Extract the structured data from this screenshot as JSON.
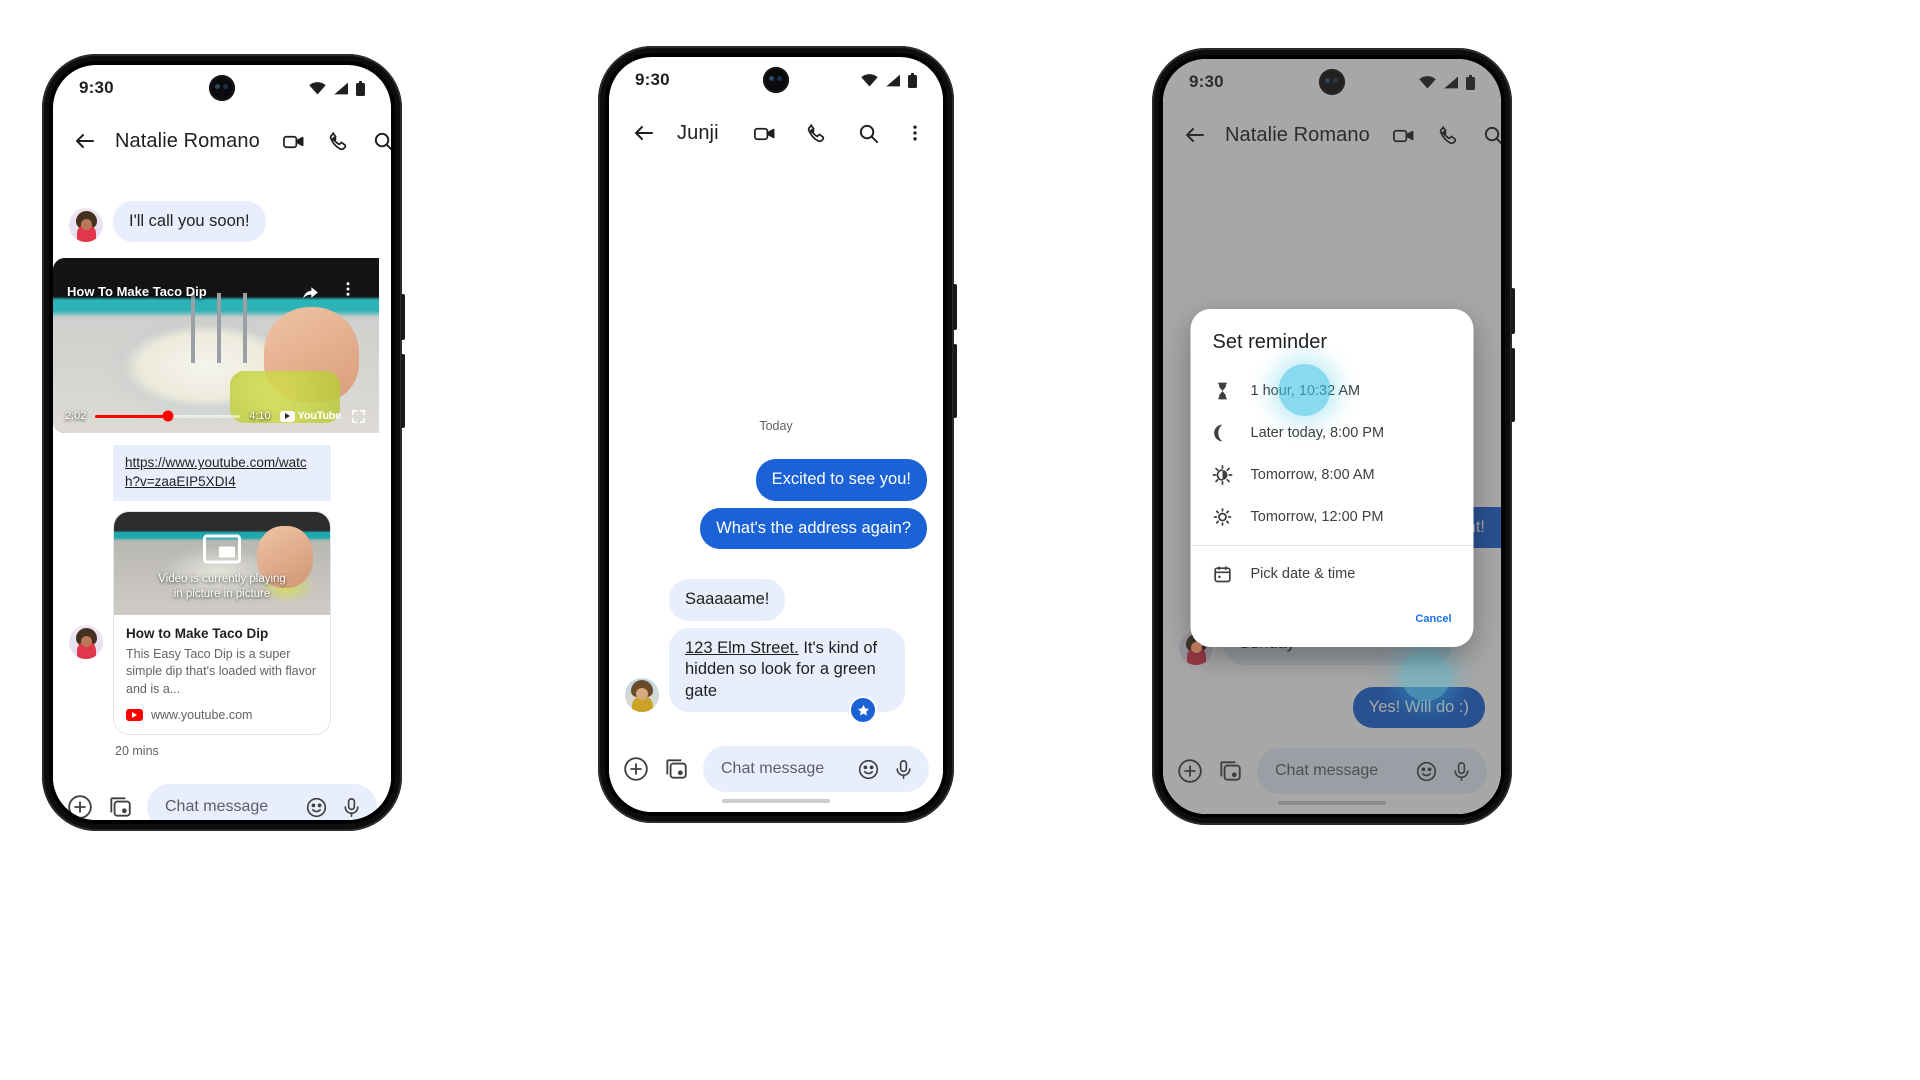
{
  "common": {
    "status": {
      "time": "9:30",
      "wifi_icon": "wifi-icon",
      "signal_icon": "signal-icon",
      "battery_icon": "battery-icon"
    },
    "appbar_icons": {
      "back": "back-arrow-icon",
      "video": "video-call-icon",
      "call": "phone-call-icon",
      "search": "search-icon",
      "more": "overflow-menu-icon"
    },
    "composer": {
      "placeholder": "Chat message",
      "plus_icon": "plus-icon",
      "gallery_icon": "gallery-icon",
      "emoji_icon": "emoji-icon",
      "mic_icon": "microphone-icon"
    },
    "colors": {
      "accent_blue": "#1b62d6",
      "bubble_in": "#e8eefb",
      "link_blue": "#1a73e8",
      "youtube_red": "#ff0000",
      "touch_cyan": "#40c4e3"
    }
  },
  "phone1": {
    "title": "Natalie Romano",
    "messages": [
      {
        "sender": "in",
        "text": "I'll call you soon!"
      }
    ],
    "video": {
      "overlay_title": "How To Make Taco Dip",
      "current_time": "2:02",
      "duration": "4:10",
      "progress_percent": 50,
      "brand": "YouTube",
      "share_icon": "share-icon",
      "more_icon": "overflow-menu-icon",
      "fullscreen_icon": "fullscreen-icon"
    },
    "link_card": {
      "url": "https://www.youtube.com/watch?v=zaaEIP5XDI4",
      "thumb_caption": "Video is currently playing\nin picture in picture",
      "thumb_caption_line1": "Video is currently playing",
      "thumb_caption_line2": "in picture in picture",
      "pip_icon": "picture-in-picture-icon",
      "title": "How to Make Taco Dip",
      "description": "This Easy Taco Dip is a super simple dip that's loaded with flavor and is a...",
      "domain": "www.youtube.com",
      "favicon": "youtube-icon"
    },
    "timestamp": "20 mins"
  },
  "phone2": {
    "title": "Junji",
    "day_divider": "Today",
    "messages": [
      {
        "sender": "out",
        "text": "Excited to see you!"
      },
      {
        "sender": "out",
        "text": "What's the address again?"
      },
      {
        "sender": "in",
        "text": "Saaaaame!"
      },
      {
        "sender": "in",
        "text_link": "123 Elm Street.",
        "text": "123 Elm Street. It's kind of hidden so look for a green gate"
      }
    ],
    "reaction_badge": "star-icon"
  },
  "phone3": {
    "title": "Natalie Romano",
    "messages": [
      {
        "sender": "out",
        "text": "night!",
        "partial": true
      },
      {
        "sender": "in",
        "text": "Let me know what Ellie says about joining on Sunday"
      },
      {
        "sender": "out",
        "text": "Yes! Will do :)"
      }
    ],
    "dialog": {
      "title": "Set reminder",
      "options": [
        {
          "icon": "hourglass-icon",
          "label": "1 hour, 10:32 AM"
        },
        {
          "icon": "moon-icon",
          "label": "Later today, 8:00 PM"
        },
        {
          "icon": "sunrise-icon",
          "label": "Tomorrow, 8:00 AM"
        },
        {
          "icon": "sun-icon",
          "label": "Tomorrow, 12:00 PM"
        },
        {
          "icon": "calendar-icon",
          "label": "Pick date & time"
        }
      ],
      "cancel_label": "Cancel"
    }
  }
}
